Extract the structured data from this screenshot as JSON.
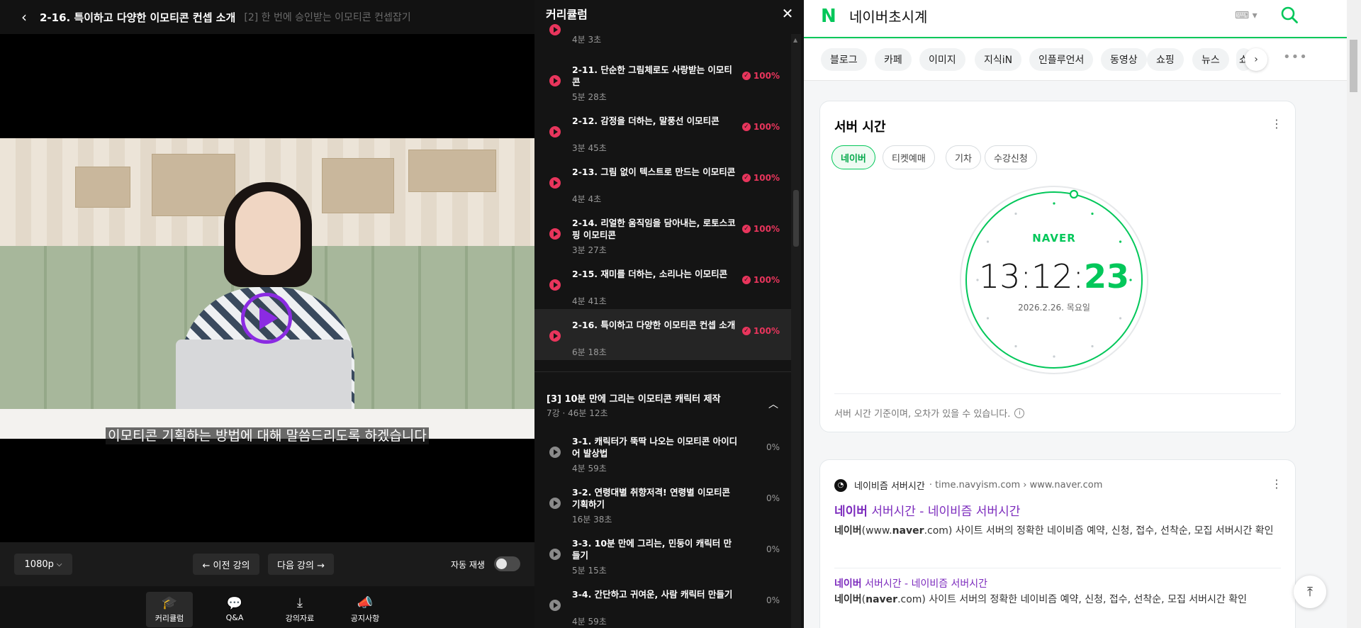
{
  "player": {
    "title": "2-16. 특이하고 다양한 이모티콘 컨셉 소개",
    "section_subtitle": "[2] 한 번에 승인받는 이모티콘 컨셉잡기",
    "caption": "이모티콘 기획하는 방법에 대해 말씀드리도록 하겠습니다",
    "quality": "1080p",
    "prev_label": "← 이전 강의",
    "next_label": "다음 강의 →",
    "autoplay_label": "자동 재생",
    "autoplay_on": false,
    "bottom_nav": [
      {
        "label": "커리큘럼",
        "icon": "graduation-cap-icon",
        "glyph": "🎓"
      },
      {
        "label": "Q&A",
        "icon": "chat-bubble-icon",
        "glyph": "💬"
      },
      {
        "label": "강의자료",
        "icon": "download-icon",
        "glyph": "⤓"
      },
      {
        "label": "공지사항",
        "icon": "megaphone-icon",
        "glyph": "📣"
      }
    ]
  },
  "curriculum": {
    "title": "커리큘럼",
    "top_partial_duration": "4분 3초",
    "lessons": [
      {
        "title": "2-11. 단순한 그림체로도 사랑받는 이모티콘",
        "duration": "5분 28초",
        "progress": "100%",
        "done": true
      },
      {
        "title": "2-12. 감정을 더하는, 말풍선 이모티콘",
        "duration": "3분 45초",
        "progress": "100%",
        "done": true
      },
      {
        "title": "2-13. 그림 없이 텍스트로 만드는 이모티콘",
        "duration": "4분 4초",
        "progress": "100%",
        "done": true
      },
      {
        "title": "2-14. 리얼한 움직임을 담아내는, 로토스코핑 이모티콘",
        "duration": "3분 27초",
        "progress": "100%",
        "done": true
      },
      {
        "title": "2-15. 재미를 더하는, 소리나는 이모티콘",
        "duration": "4분 41초",
        "progress": "100%",
        "done": true
      },
      {
        "title": "2-16. 특이하고 다양한 이모티콘 컨셉 소개",
        "duration": "6분 18초",
        "progress": "100%",
        "done": true,
        "current": true
      }
    ],
    "section": {
      "title": "[3] 10분 만에 그리는 이모티콘 캐릭터 제작",
      "meta": "7강 · 46분 12초"
    },
    "section_lessons": [
      {
        "title": "3-1. 캐릭터가 뚝딱 나오는 이모티콘 아이디어 발상법",
        "duration": "4분 59초",
        "progress": "0%",
        "done": false
      },
      {
        "title": "3-2. 연령대별 취향저격! 연령별 이모티콘 기획하기",
        "duration": "16분 38초",
        "progress": "0%",
        "done": false
      },
      {
        "title": "3-3. 10분 만에 그리는, 민둥이 캐릭터 만들기",
        "duration": "5분 15초",
        "progress": "0%",
        "done": false
      },
      {
        "title": "3-4. 간단하고 귀여운, 사람 캐릭터 만들기",
        "duration": "4분 59초",
        "progress": "0%",
        "done": false
      }
    ]
  },
  "naver": {
    "logo": "N",
    "query": "네이버초시계",
    "keyboard_icon": "⌨ ▾",
    "tabs": [
      "블로그",
      "카페",
      "이미지",
      "지식iN",
      "인플루언서",
      "동영상",
      "쇼핑",
      "뉴스",
      "쇼"
    ],
    "server_card": {
      "title": "서버 시간",
      "pills": [
        "네이버",
        "티켓예매",
        "기차",
        "수강신청"
      ],
      "active_pill": 0,
      "brand": "NAVER",
      "time_hm": "13:12:",
      "time_s": "23",
      "date": "2026.2.26. 목요일",
      "note": "서버 시간 기준이며, 오차가 있을 수 있습니다."
    },
    "result": {
      "source_name": "네이비즘 서버시간",
      "source_url": "· time.navyism.com › www.naver.com",
      "link_highlight": "네이버",
      "link_rest": " 서버시간 - 네이비즘 서버시간",
      "desc_bold1": "네이버",
      "desc_part1": "(www.",
      "desc_bold2": "naver",
      "desc_part2": ".com) 사이트 서버의 정확한 네이비즘 예약, 신청, 접수, 선착순, 모집 서버시간 확인",
      "link2_highlight": "네이버",
      "link2_rest": " 서버시간 - 네이비즘 서버시간",
      "desc2_bold1": "네이버",
      "desc2_part1": "(",
      "desc2_bold2": "naver",
      "desc2_part2": ".com) 사이트 서버의 정확한 네이비즘 예약, 신청, 접수, 선착순, 모집 서버시간 확인"
    },
    "colors": {
      "brand_green": "#03c75a",
      "visited_link": "#7c2bbd"
    }
  },
  "colors": {
    "accent_pink": "#e8355c",
    "play_purple": "#8b2be2"
  }
}
